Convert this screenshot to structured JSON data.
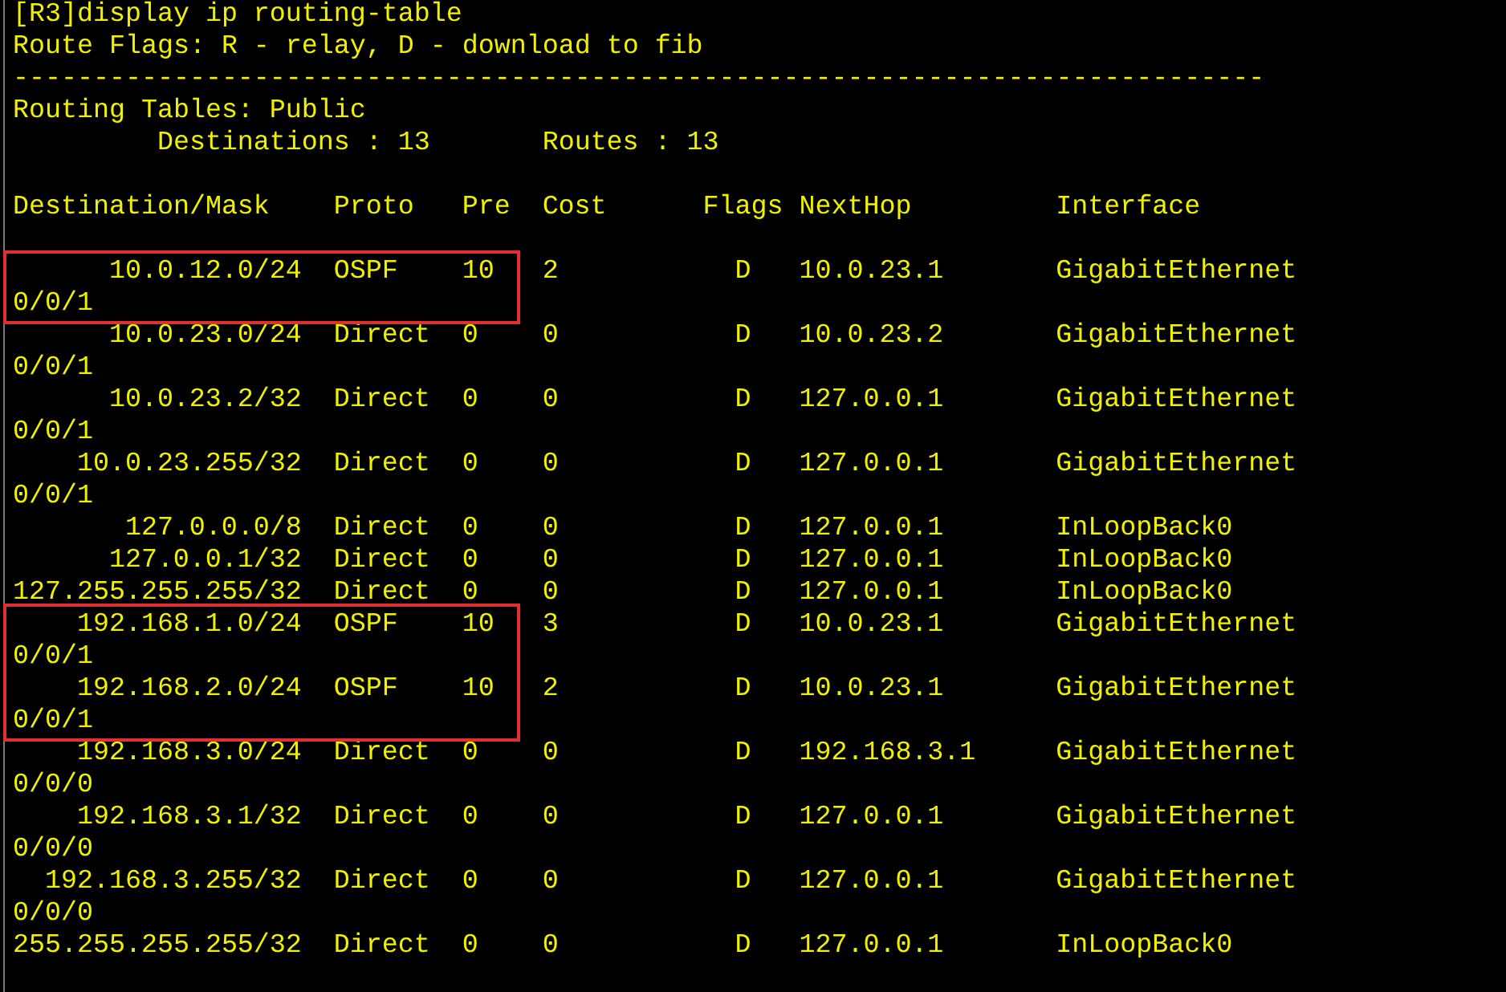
{
  "command": "[R3]display ip routing-table",
  "flags_legend": "Route Flags: R - relay, D - download to fib",
  "separator": "------------------------------------------------------------------------------",
  "table_title": "Routing Tables: Public",
  "destinations": "Destinations : 13",
  "routes": "Routes : 13",
  "columns": [
    "Destination/Mask",
    "Proto",
    "Pre",
    "Cost",
    "Flags",
    "NextHop",
    "Interface"
  ],
  "rows": [
    {
      "destination": "10.0.12.0/24",
      "proto": "OSPF",
      "pre": "10",
      "cost": "2",
      "flags": "D",
      "nexthop": "10.0.23.1",
      "interface": "GigabitEthernet",
      "interface_continued": "0/0/1",
      "highlighted": true
    },
    {
      "destination": "10.0.23.0/24",
      "proto": "Direct",
      "pre": "0",
      "cost": "0",
      "flags": "D",
      "nexthop": "10.0.23.2",
      "interface": "GigabitEthernet",
      "interface_continued": "0/0/1",
      "highlighted": false
    },
    {
      "destination": "10.0.23.2/32",
      "proto": "Direct",
      "pre": "0",
      "cost": "0",
      "flags": "D",
      "nexthop": "127.0.0.1",
      "interface": "GigabitEthernet",
      "interface_continued": "0/0/1",
      "highlighted": false
    },
    {
      "destination": "10.0.23.255/32",
      "proto": "Direct",
      "pre": "0",
      "cost": "0",
      "flags": "D",
      "nexthop": "127.0.0.1",
      "interface": "GigabitEthernet",
      "interface_continued": "0/0/1",
      "highlighted": false
    },
    {
      "destination": "127.0.0.0/8",
      "proto": "Direct",
      "pre": "0",
      "cost": "0",
      "flags": "D",
      "nexthop": "127.0.0.1",
      "interface": "InLoopBack0",
      "highlighted": false
    },
    {
      "destination": "127.0.0.1/32",
      "proto": "Direct",
      "pre": "0",
      "cost": "0",
      "flags": "D",
      "nexthop": "127.0.0.1",
      "interface": "InLoopBack0",
      "highlighted": false
    },
    {
      "destination": "127.255.255.255/32",
      "proto": "Direct",
      "pre": "0",
      "cost": "0",
      "flags": "D",
      "nexthop": "127.0.0.1",
      "interface": "InLoopBack0",
      "highlighted": false
    },
    {
      "destination": "192.168.1.0/24",
      "proto": "OSPF",
      "pre": "10",
      "cost": "3",
      "flags": "D",
      "nexthop": "10.0.23.1",
      "interface": "GigabitEthernet",
      "interface_continued": "0/0/1",
      "highlighted": true
    },
    {
      "destination": "192.168.2.0/24",
      "proto": "OSPF",
      "pre": "10",
      "cost": "2",
      "flags": "D",
      "nexthop": "10.0.23.1",
      "interface": "GigabitEthernet",
      "interface_continued": "0/0/1",
      "highlighted": true
    },
    {
      "destination": "192.168.3.0/24",
      "proto": "Direct",
      "pre": "0",
      "cost": "0",
      "flags": "D",
      "nexthop": "192.168.3.1",
      "interface": "GigabitEthernet",
      "interface_continued": "0/0/0",
      "highlighted": false
    },
    {
      "destination": "192.168.3.1/32",
      "proto": "Direct",
      "pre": "0",
      "cost": "0",
      "flags": "D",
      "nexthop": "127.0.0.1",
      "interface": "GigabitEthernet",
      "interface_continued": "0/0/0",
      "highlighted": false
    },
    {
      "destination": "192.168.3.255/32",
      "proto": "Direct",
      "pre": "0",
      "cost": "0",
      "flags": "D",
      "nexthop": "127.0.0.1",
      "interface": "GigabitEthernet",
      "interface_continued": "0/0/0",
      "highlighted": false
    },
    {
      "destination": "255.255.255.255/32",
      "proto": "Direct",
      "pre": "0",
      "cost": "0",
      "flags": "D",
      "nexthop": "127.0.0.1",
      "interface": "InLoopBack0",
      "highlighted": false
    }
  ]
}
